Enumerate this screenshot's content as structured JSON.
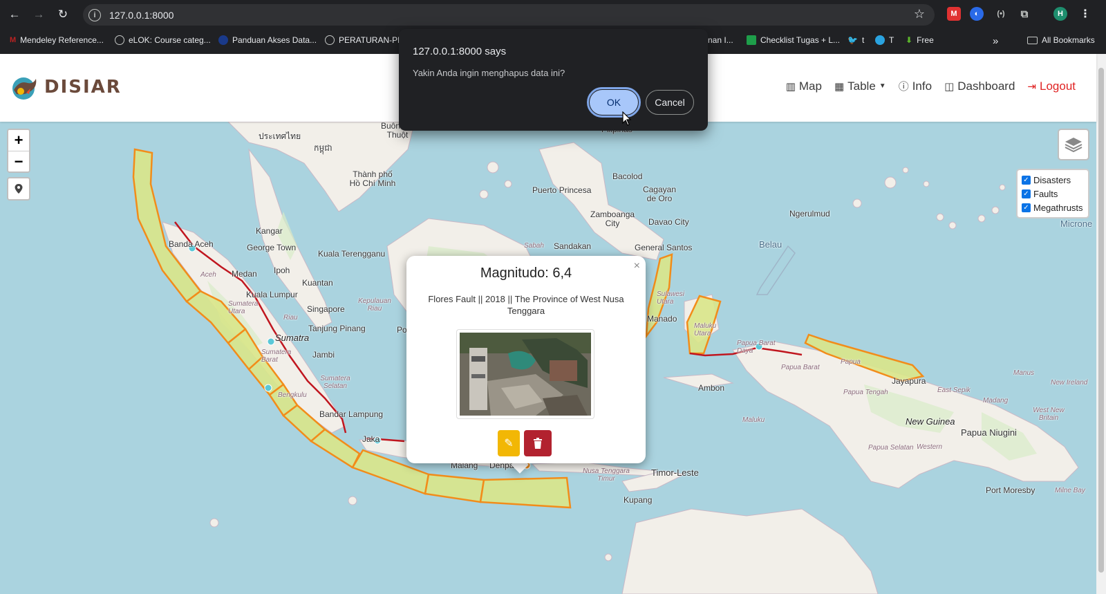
{
  "browser": {
    "url": "127.0.0.1:8000",
    "profile_initial": "H",
    "bookmarks": [
      {
        "label": "Mendeley Reference..."
      },
      {
        "label": "eLOK: Course categ..."
      },
      {
        "label": "Panduan Akses Data..."
      },
      {
        "label": "PERATURAN-PR"
      },
      {
        "label": "nan I..."
      },
      {
        "label": "Checklist Tugas + L..."
      },
      {
        "label": "t"
      },
      {
        "label": "T"
      },
      {
        "label": "Free"
      }
    ],
    "all_bookmarks_label": "All Bookmarks"
  },
  "dialog": {
    "title": "127.0.0.1:8000 says",
    "message": "Yakin Anda ingin menghapus data ini?",
    "ok_label": "OK",
    "cancel_label": "Cancel"
  },
  "navbar": {
    "brand": "DISIAR",
    "links": {
      "map": "Map",
      "table": "Table",
      "info": "Info",
      "dashboard": "Dashboard",
      "logout": "Logout"
    }
  },
  "map": {
    "zoom_in": "+",
    "zoom_out": "−",
    "layers": [
      {
        "label": "Disasters",
        "checked": true
      },
      {
        "label": "Faults",
        "checked": true
      },
      {
        "label": "Megathrusts",
        "checked": true
      }
    ],
    "labels": {
      "banda_aceh": "Banda Aceh",
      "medan": "Medan",
      "sumatra": "Sumatra",
      "jambi": "Jambi",
      "bandar_lampung": "Bandar Lampung",
      "jakarta": "Jaka",
      "malang": "Malang",
      "denpasar": "Denpasar",
      "kupang": "Kupang",
      "timor_leste": "Timor-Leste",
      "ambon": "Ambon",
      "jayapura": "Jayapura",
      "new_guinea": "New Guinea",
      "papua_niugini": "Papua Niugini",
      "port_moresby": "Port Moresby",
      "puerto_princesa": "Puerto Princesa",
      "bacolod": "Bacolod",
      "cagayan": "Cagayan de Oro",
      "zamboanga": "Zamboanga City",
      "davao": "Davao City",
      "general_santos": "General Santos",
      "sandakan": "Sandakan",
      "kuala_lumpur": "Kuala Lumpur",
      "singapore": "Singapore",
      "ipoh": "Ipoh",
      "kuantan": "Kuantan",
      "kuala_terengganu": "Kuala Terengganu",
      "george_town": "George Town",
      "kangar": "Kangar",
      "tanjung_pinang": "Tanjung Pinang",
      "ho_chi_minh": "Thành phố Hồ Chí Minh",
      "buon_ma_thuot": "Buôn Ma Thuột",
      "ngerulmud": "Ngerulmud",
      "belau": "Belau",
      "micronesia": "Microne",
      "manado": "Manado",
      "sabah": "Sabah",
      "aceh": "Aceh",
      "sumatera_utara": "Sumatera Utara",
      "sumatera_barat": "Sumatera Barat",
      "sumatera_selatan": "Sumatera Selatan",
      "bengkulu": "Bengkulu",
      "riau": "Riau",
      "kepulauan_riau": "Kepulauan Riau",
      "papua_barat": "Papua Barat",
      "papua_barat_daya": "Papua Barat Daya",
      "papua": "Papua",
      "papua_tengah": "Papua Tengah",
      "papua_selatan": "Papua Selatan",
      "maluku": "Maluku",
      "maluku_utara": "Maluku Utara",
      "sulawesi_utara": "Sulawesi Utara",
      "nusa_tenggara_timur": "Nusa Tenggara Timur",
      "east_sepik": "East Sepik",
      "madang": "Madang",
      "manus": "Manus",
      "new_ireland": "New Ireland",
      "west_new_britain": "West New Britain",
      "milne_bay": "Milne Bay",
      "western": "Western",
      "cambodia": "កម្ពុជា",
      "thailand": "ประเทศไทย",
      "philippines": "Pilipinas",
      "por": "Por"
    }
  },
  "popup": {
    "title": "Magnitudo: 6,4",
    "description": "Flores Fault || 2018 || The Province of West Nusa Tenggara",
    "close": "×"
  },
  "colors": {
    "megathrust_fill": "#d9e58a",
    "megathrust_stroke": "#f28c1a",
    "fault_line": "#c0161f",
    "edit_button": "#f2b705",
    "delete_button": "#b2222f",
    "ok_button": "#a8c7fa",
    "logout": "#e02424"
  }
}
